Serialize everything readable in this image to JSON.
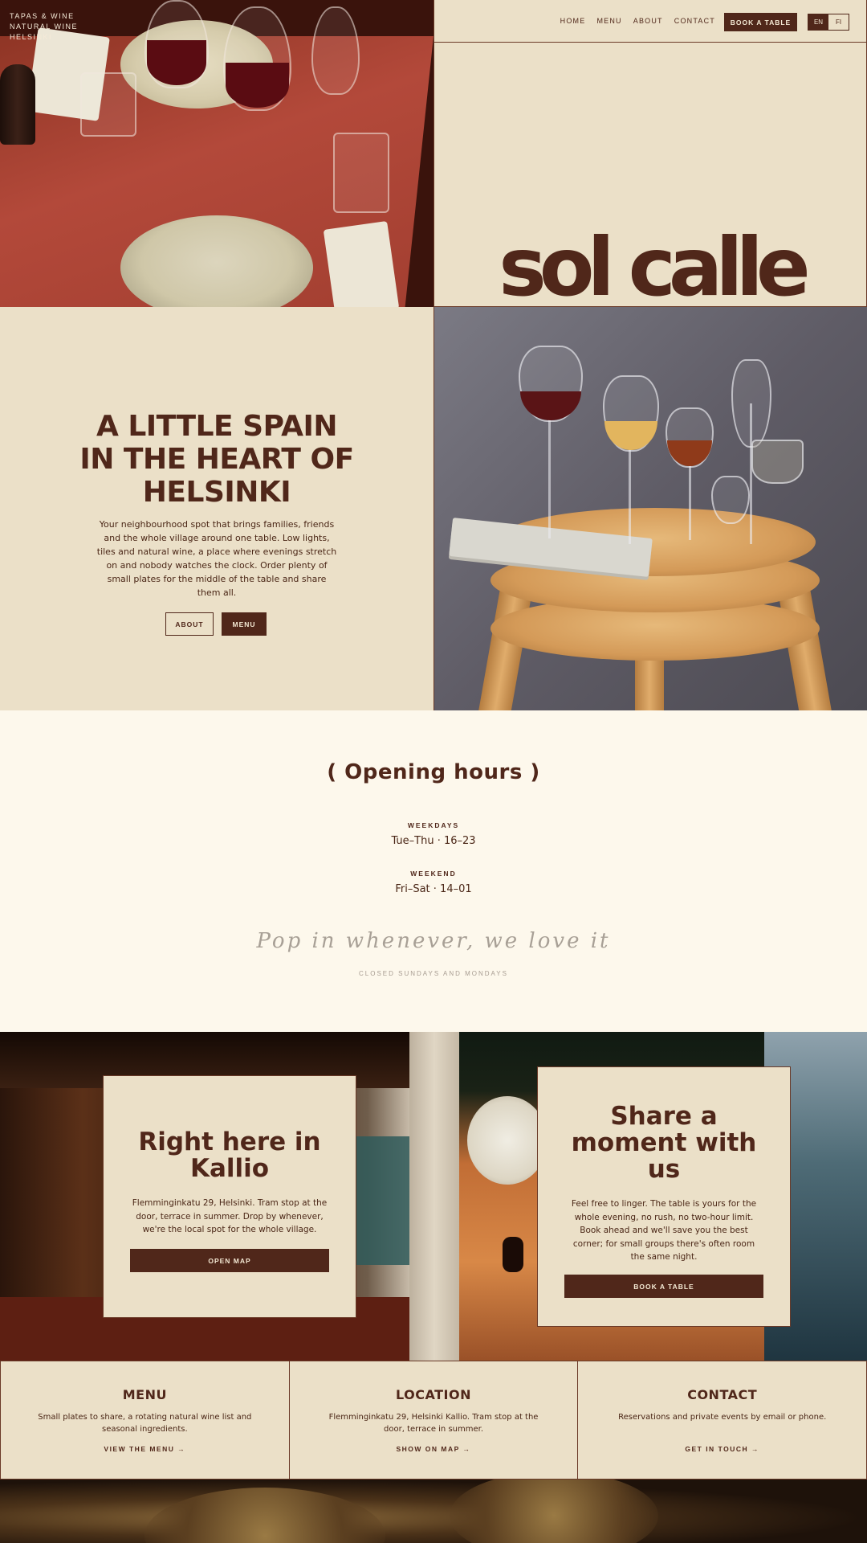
{
  "hero": {
    "kicker": [
      "TAPAS & WINE",
      "NATURAL WINE",
      "HELSINKI"
    ],
    "logo": "sol calle"
  },
  "nav": {
    "links": [
      "HOME",
      "MENU",
      "ABOUT",
      "CONTACT"
    ],
    "book_label": "BOOK A TABLE",
    "lang_en": "EN",
    "lang_fi": "FI"
  },
  "intro": {
    "title_lines": [
      "A LITTLE SPAIN",
      "IN THE HEART OF",
      "HELSINKI"
    ],
    "text": "Your neighbourhood spot that brings families, friends and the whole village around one table. Low lights, tiles and natural wine, a place where evenings stretch on and nobody watches the clock. Order plenty of small plates for the middle of the table and share them all.",
    "about_label": "ABOUT",
    "menu_label": "MENU"
  },
  "hours": {
    "title": "( Opening hours )",
    "weekdays_label": "WEEKDAYS",
    "weekdays_value": "Tue–Thu · 16–23",
    "weekend_label": "WEEKEND",
    "weekend_value": "Fri–Sat · 14–01",
    "script": "Pop in whenever,   we love it",
    "note": "CLOSED SUNDAYS AND MONDAYS"
  },
  "cards": {
    "kallio_title": "Right here in Kallio",
    "kallio_text": "Flemminginkatu 29, Helsinki. Tram stop at the door, terrace in summer. Drop by whenever, we're the local spot for the whole village.",
    "kallio_button": "OPEN MAP",
    "share_title": "Share a moment with us",
    "share_text": "Feel free to linger. The table is yours for the whole evening, no rush, no two-hour limit. Book ahead and we'll save you the best corner; for small groups there's often room the same night.",
    "share_button": "BOOK A TABLE"
  },
  "info": [
    {
      "title": "MENU",
      "text": "Small plates to share, a rotating natural wine list and seasonal ingredients.",
      "link": "VIEW THE MENU →"
    },
    {
      "title": "LOCATION",
      "text": "Flemminginkatu 29, Helsinki Kallio. Tram stop at the door, terrace in summer.",
      "link": "SHOW ON MAP →"
    },
    {
      "title": "CONTACT",
      "text": "Reservations and private events by email or phone.",
      "link": "GET IN TOUCH →"
    }
  ],
  "colors": {
    "brown": "#50271a",
    "cream": "#ebe0c8",
    "paper": "#fdf8ec"
  }
}
